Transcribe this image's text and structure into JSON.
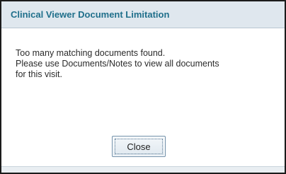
{
  "dialog": {
    "title": "Clinical Viewer Document Limitation",
    "message_line1": "Too many matching documents found.",
    "message_line2": "Please use Documents/Notes to view all documents",
    "message_line3": "for this visit.",
    "close_label": "Close"
  }
}
